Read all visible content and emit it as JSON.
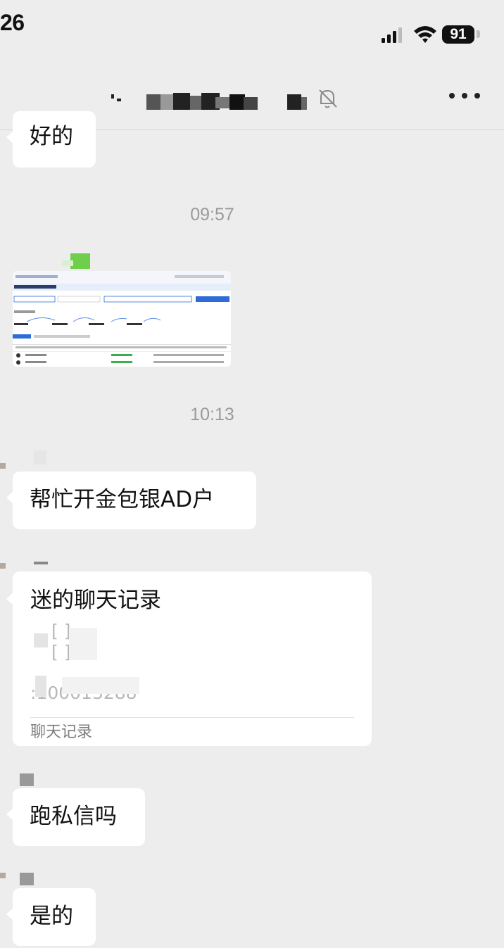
{
  "status_bar": {
    "time": "26",
    "battery": "91"
  },
  "header": {
    "more_icon": "ellipsis-icon",
    "mute_icon": "bell-off-icon"
  },
  "messages": {
    "m1": "好的",
    "ts1": "09:57",
    "ts2": "10:13",
    "m2": "帮忙开金包银AD户",
    "record": {
      "title": "迷的聊天记录",
      "line1": "[     ]",
      "line2": "[     ]",
      "line3": ":100013288",
      "footer": "聊天记录"
    },
    "m3": "跑私信吗",
    "m4": "是的"
  }
}
